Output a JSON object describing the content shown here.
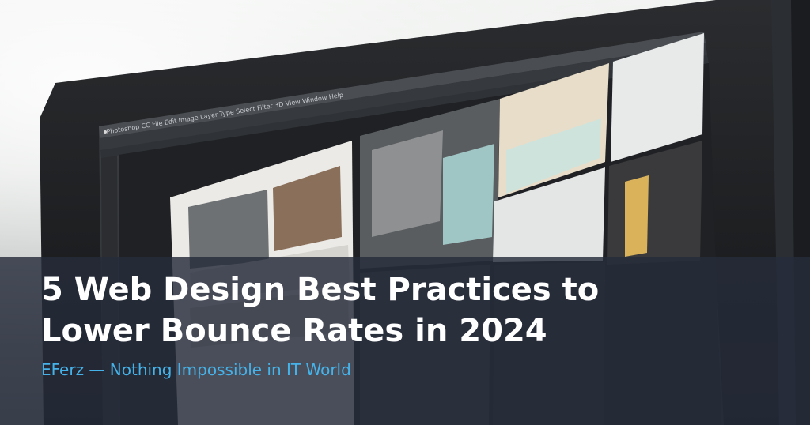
{
  "article": {
    "title_line1": "5 Web Design Best Practices to",
    "title_line2": "Lower Bounce Rates in 2024",
    "site_tagline": "EFerz — Nothing Impossible in IT World"
  },
  "colors": {
    "overlay": "#262c3a",
    "title": "#ffffff",
    "tagline": "#45b3e9"
  },
  "icons": [
    "apple-logo-icon"
  ]
}
